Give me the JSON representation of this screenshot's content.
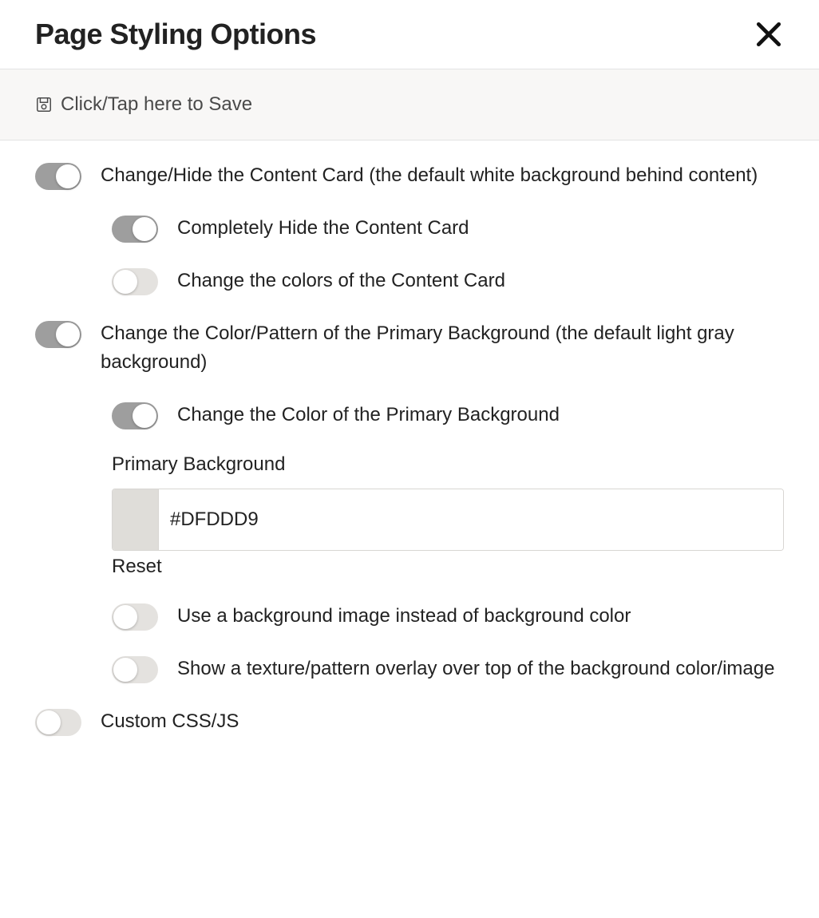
{
  "header": {
    "title": "Page Styling Options"
  },
  "save_bar": {
    "label": "Click/Tap here to Save"
  },
  "options": {
    "content_card": {
      "label": "Change/Hide the Content Card (the default white background behind content)",
      "state": true,
      "hide": {
        "label": "Completely Hide the Content Card",
        "state": true
      },
      "colors": {
        "label": "Change the colors of the Content Card",
        "state": false
      }
    },
    "primary_bg": {
      "label": "Change the Color/Pattern of the Primary Background (the default light gray background)",
      "state": true,
      "change_color": {
        "label": "Change the Color of the Primary Background",
        "state": true
      },
      "color_field": {
        "label": "Primary Background",
        "value": "#DFDDD9",
        "swatch": "#DFDDD9",
        "reset_label": "Reset"
      },
      "bg_image": {
        "label": "Use a background image instead of background color",
        "state": false
      },
      "texture": {
        "label": "Show a texture/pattern overlay over top of the background color/image",
        "state": false
      }
    },
    "custom_css": {
      "label": "Custom CSS/JS",
      "state": false
    }
  }
}
